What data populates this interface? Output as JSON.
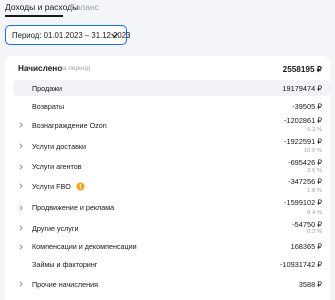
{
  "tabs": [
    {
      "label": "Доходы и расходы"
    },
    {
      "label": "Баланс"
    }
  ],
  "period": {
    "label": "Период: 01.01.2023 – 31.12.2023"
  },
  "summary": {
    "title": "Начислено",
    "subtitle": "за период",
    "value": "2558195 ₽"
  },
  "rows": [
    {
      "label": "Продажи",
      "value": "19179474 ₽",
      "pct": "",
      "expandable": false,
      "highlight": true
    },
    {
      "label": "Возвраты",
      "value": "-39505 ₽",
      "pct": "",
      "expandable": false,
      "highlight": false
    },
    {
      "label": "Вознаграждение Ozon",
      "value": "-1202861 ₽",
      "pct": "6.3 %",
      "expandable": true,
      "highlight": false
    },
    {
      "label": "Услуги доставки",
      "value": "-1922591 ₽",
      "pct": "10.0 %",
      "expandable": true,
      "highlight": false
    },
    {
      "label": "Услуги агентов",
      "value": "-695426 ₽",
      "pct": "3.6 %",
      "expandable": true,
      "highlight": false
    },
    {
      "label": "Услуги FBO",
      "value": "-347256 ₽",
      "pct": "1.8 %",
      "expandable": true,
      "highlight": false,
      "warning": true
    },
    {
      "label": "Продвижение и реклама",
      "value": "-1599102 ₽",
      "pct": "8.4 %",
      "expandable": true,
      "highlight": false
    },
    {
      "label": "Другие услуги",
      "value": "-54750 ₽",
      "pct": "0.3 %",
      "expandable": true,
      "highlight": false
    },
    {
      "label": "Компенсации и декомпенсации",
      "value": "168365 ₽",
      "pct": "",
      "expandable": true,
      "highlight": false
    },
    {
      "label": "Займы и факторинг",
      "value": "-10931742 ₽",
      "pct": "",
      "expandable": false,
      "highlight": false
    },
    {
      "label": "Прочие начисления",
      "value": "3588 ₽",
      "pct": "",
      "expandable": true,
      "highlight": false
    }
  ],
  "colors": {
    "accent": "#1d6bf3",
    "warning": "#f5a623",
    "muted": "#9aa1ab"
  }
}
